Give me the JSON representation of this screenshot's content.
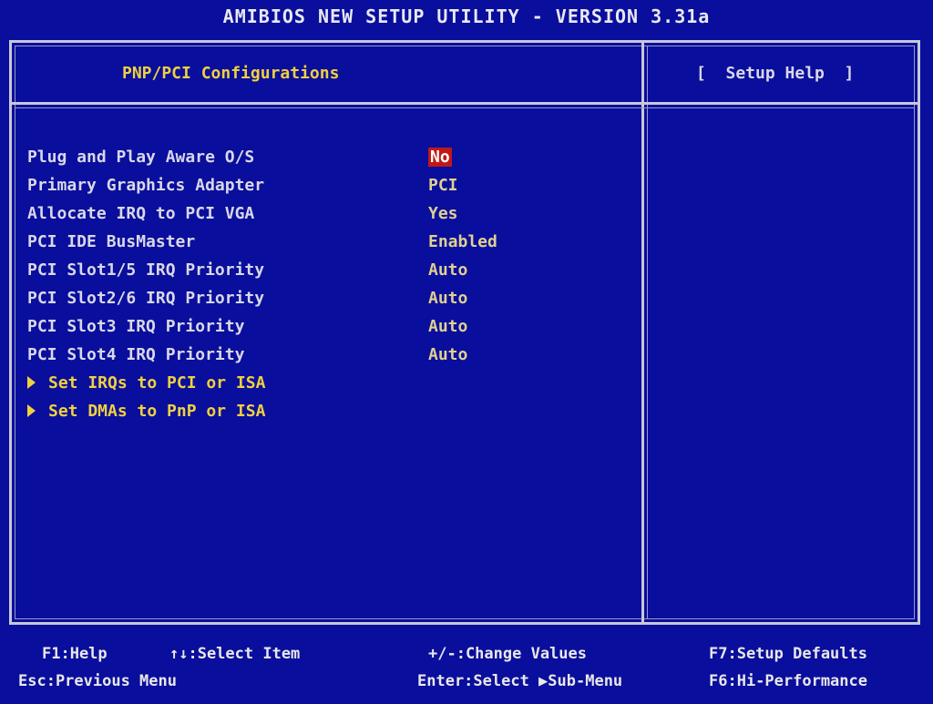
{
  "title": "AMIBIOS NEW SETUP UTILITY - VERSION 3.31a",
  "section_title": "PNP/PCI Configurations",
  "help_title": "[  Setup Help  ]",
  "colors": {
    "background": "#0a0e9c",
    "highlight": "#c01818",
    "text": "#d8d8e8",
    "accent": "#f0d040"
  },
  "settings": [
    {
      "label": "Plug and Play Aware O/S",
      "value": "No",
      "selected": true
    },
    {
      "label": "Primary Graphics Adapter",
      "value": "PCI"
    },
    {
      "label": "Allocate IRQ to PCI VGA",
      "value": "Yes"
    },
    {
      "label": "PCI IDE BusMaster",
      "value": "Enabled"
    },
    {
      "label": "PCI Slot1/5 IRQ Priority",
      "value": "Auto"
    },
    {
      "label": "PCI Slot2/6 IRQ Priority",
      "value": "Auto"
    },
    {
      "label": "PCI Slot3 IRQ Priority",
      "value": "Auto"
    },
    {
      "label": "PCI Slot4 IRQ Priority",
      "value": "Auto"
    }
  ],
  "submenus": [
    {
      "label": "Set IRQs to PCI or ISA",
      "icon": "triangle-right-icon"
    },
    {
      "label": "Set DMAs to PnP or ISA",
      "icon": "triangle-right-icon"
    }
  ],
  "footer": {
    "help": "F1:Help",
    "select_item": "↑↓:Select Item",
    "change_values": "+/-:Change Values",
    "setup_defaults": "F7:Setup Defaults",
    "previous_menu": "Esc:Previous Menu",
    "select_submenu": "Enter:Select ▶Sub-Menu",
    "hi_performance": "F6:Hi-Performance"
  }
}
